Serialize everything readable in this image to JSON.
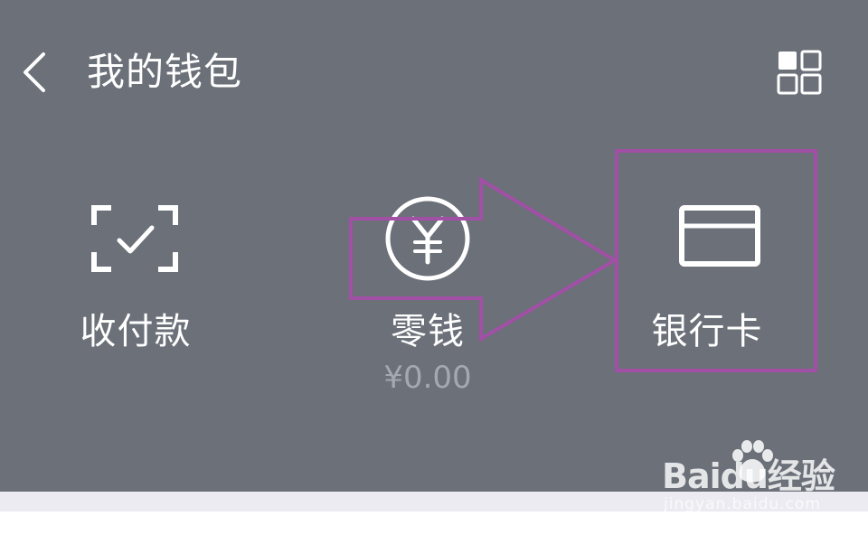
{
  "header": {
    "title": "我的钱包",
    "back_icon": "chevron-left-icon",
    "menu_icon": "grid-icon"
  },
  "features": [
    {
      "label": "收付款",
      "icon": "scan-check-icon"
    },
    {
      "label": "零钱",
      "icon": "yen-circle-icon",
      "sub": "¥0.00"
    },
    {
      "label": "银行卡",
      "icon": "bank-card-icon"
    }
  ],
  "colors": {
    "panel": "#6b7079",
    "annotation": "#a24fa6",
    "text": "#ffffff",
    "subtext": "#a4a8b0"
  },
  "watermark": {
    "logo_text": "Baidu经验",
    "url": "jingyan.baidu.com"
  }
}
